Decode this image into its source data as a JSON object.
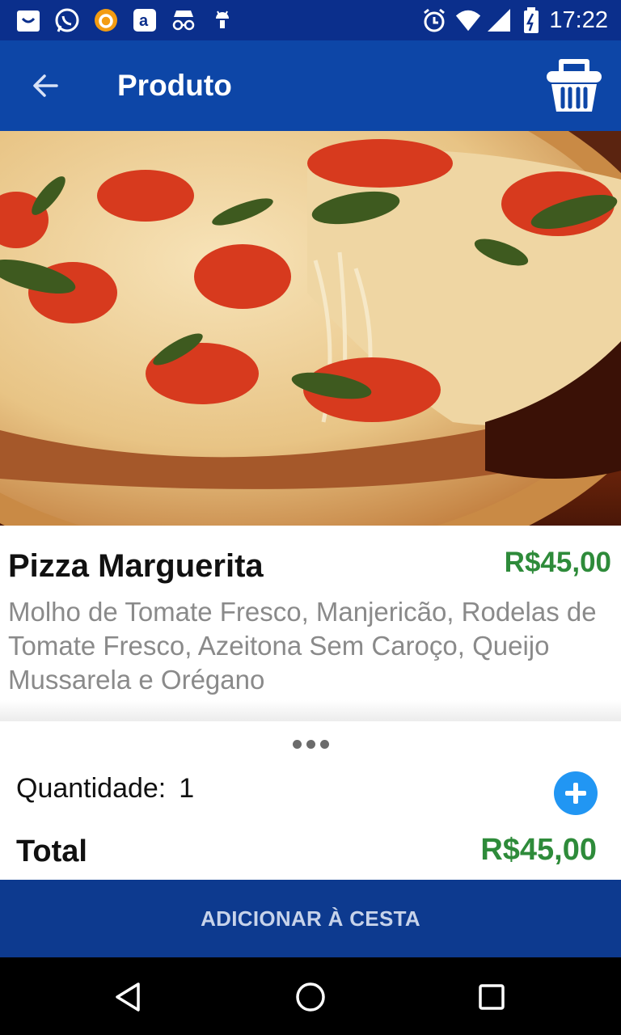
{
  "status_bar": {
    "time": "17:22",
    "left_icons": [
      "shopping-bag-icon",
      "whatsapp-icon",
      "avast-icon",
      "amazon-icon",
      "incognito-icon",
      "android-icon"
    ],
    "right_icons": [
      "alarm-icon",
      "wifi-icon",
      "signal-icon",
      "battery-icon"
    ]
  },
  "app_bar": {
    "title": "Produto",
    "back_icon": "arrow-back-icon",
    "cart_icon": "basket-icon"
  },
  "hero": {
    "image": "pizza-photo"
  },
  "product": {
    "name": "Pizza Marguerita",
    "price": "R$45,00",
    "description": "Molho de Tomate Fresco, Manjericão, Rodelas de Tomate Fresco, Azeitona Sem Caroço, Queijo Mussarela e Orégano"
  },
  "order": {
    "quantity_label": "Quantidade:",
    "quantity": "1",
    "total_label": "Total",
    "total_value": "R$45,00",
    "more_icon": "more-horizontal-icon",
    "plus_icon": "add-circle-icon"
  },
  "add_button": {
    "label": "ADICIONAR À CESTA"
  },
  "nav_bar": {
    "icons": [
      "back-triangle-icon",
      "home-circle-icon",
      "recents-square-icon"
    ]
  },
  "colors": {
    "status_bar": "#0b2f8c",
    "app_bar": "#0d46a7",
    "add_button": "#0d3a8f",
    "price_green": "#2e8b3a",
    "plus_blue": "#2196f3"
  }
}
